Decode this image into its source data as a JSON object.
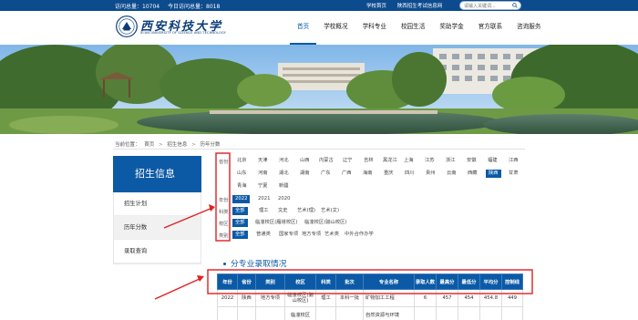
{
  "topbar": {
    "visits_label": "访问总量：10704",
    "today_label": "今日访问总量：8018",
    "links": [
      "学校首页",
      "陕西招生考试信息网"
    ],
    "search_placeholder": "请输入关键词..."
  },
  "logo": {
    "cn": "西安科技大学",
    "en": "XI'AN UNIVERSITY OF SCIENCE AND TECHNOLOGY",
    "seal_text": "西安科技大学"
  },
  "nav": [
    "首页",
    "学校概况",
    "学科专业",
    "校园生活",
    "奖助学金",
    "官方联系",
    "咨询服务"
  ],
  "breadcrumb": {
    "prefix": "当前位置：",
    "items": [
      "首页",
      "招生信息",
      "历年分数"
    ],
    "sep": ">"
  },
  "sidebar": {
    "title": "招生信息",
    "items": [
      "招生计划",
      "历年分数",
      "录取查询"
    ]
  },
  "filters": {
    "region_label": "省份",
    "regions_row1": [
      "北京",
      "天津",
      "河北",
      "山西",
      "内蒙古",
      "辽宁",
      "吉林",
      "黑龙江",
      "上海",
      "江苏",
      "浙江",
      "安徽",
      "福建",
      "江西"
    ],
    "regions_row2": [
      "山东",
      "河南",
      "湖北",
      "湖南",
      "广东",
      "广西",
      "海南",
      "重庆",
      "四川",
      "贵州",
      "云南",
      "西藏",
      "陕西",
      "甘肃"
    ],
    "regions_row3": [
      "青海",
      "宁夏",
      "新疆"
    ],
    "active_region": "陕西",
    "year_label": "年份",
    "years": [
      "2022",
      "2021",
      "2020"
    ],
    "type_label": "科类",
    "types": [
      "全部",
      "理工",
      "文史",
      "艺术(理)",
      "艺术(文)"
    ],
    "campus_label": "校区",
    "campuses": [
      "全部",
      "临潼校区(雁塔校区)",
      "临潼校区(骊山校区)"
    ],
    "batch_label": "类别",
    "batches": [
      "全部",
      "普通类",
      "国家专项",
      "地方专项",
      "艺术类",
      "中外合作办学"
    ]
  },
  "section_title": "分专业录取情况",
  "table": {
    "headers": [
      "年份",
      "省份",
      "类别",
      "校区",
      "科类",
      "批次",
      "专业名称",
      "录取人数",
      "最高分",
      "最低分",
      "平均分",
      "控制线"
    ],
    "rows": [
      [
        "2022",
        "陕西",
        "地方专项",
        "临潼校区(骊山校区)",
        "理工",
        "本科一批",
        "矿物加工工程",
        "6",
        "457",
        "454",
        "454.8",
        "449"
      ],
      [
        "",
        "",
        "",
        "临潼校区",
        "",
        "",
        "自然资源与环境",
        "",
        "",
        "",
        "",
        ""
      ]
    ]
  },
  "colors": {
    "brand": "#0c5aa6",
    "topbar": "#0c4b8e",
    "annotation": "#e02020"
  }
}
